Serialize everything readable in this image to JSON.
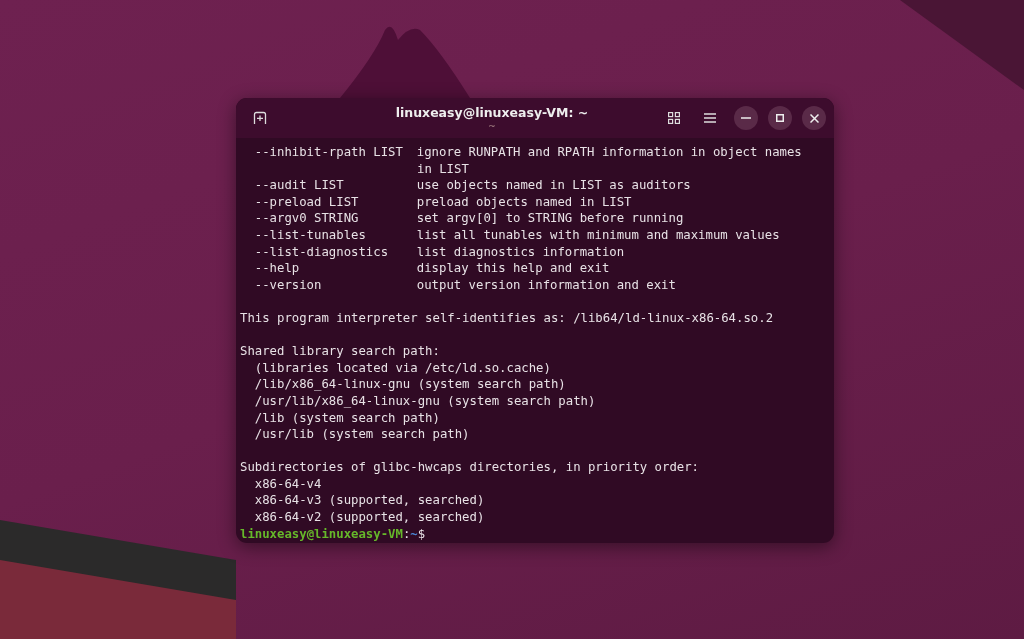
{
  "window": {
    "title": "linuxeasy@linuxeasy-VM: ~",
    "subtitle": "~"
  },
  "lines": [
    {
      "kind": "option",
      "option": "--inhibit-rpath LIST",
      "description": "ignore RUNPATH and RPATH information in object names"
    },
    {
      "kind": "continuation",
      "text": "in LIST"
    },
    {
      "kind": "option",
      "option": "--audit LIST",
      "description": "use objects named in LIST as auditors"
    },
    {
      "kind": "option",
      "option": "--preload LIST",
      "description": "preload objects named in LIST"
    },
    {
      "kind": "option",
      "option": "--argv0 STRING",
      "description": "set argv[0] to STRING before running"
    },
    {
      "kind": "option",
      "option": "--list-tunables",
      "description": "list all tunables with minimum and maximum values"
    },
    {
      "kind": "option",
      "option": "--list-diagnostics",
      "description": "list diagnostics information"
    },
    {
      "kind": "option",
      "option": "--help",
      "description": "display this help and exit"
    },
    {
      "kind": "option",
      "option": "--version",
      "description": "output version information and exit"
    },
    {
      "kind": "blank"
    },
    {
      "kind": "text",
      "text": "This program interpreter self-identifies as: /lib64/ld-linux-x86-64.so.2"
    },
    {
      "kind": "blank"
    },
    {
      "kind": "text",
      "text": "Shared library search path:"
    },
    {
      "kind": "indented",
      "text": "(libraries located via /etc/ld.so.cache)"
    },
    {
      "kind": "indented",
      "text": "/lib/x86_64-linux-gnu (system search path)"
    },
    {
      "kind": "indented",
      "text": "/usr/lib/x86_64-linux-gnu (system search path)"
    },
    {
      "kind": "indented",
      "text": "/lib (system search path)"
    },
    {
      "kind": "indented",
      "text": "/usr/lib (system search path)"
    },
    {
      "kind": "blank"
    },
    {
      "kind": "text",
      "text": "Subdirectories of glibc-hwcaps directories, in priority order:"
    },
    {
      "kind": "indented",
      "text": "x86-64-v4"
    },
    {
      "kind": "indented",
      "text": "x86-64-v3 (supported, searched)"
    },
    {
      "kind": "indented",
      "text": "x86-64-v2 (supported, searched)"
    },
    {
      "kind": "prompt",
      "user_host": "linuxeasy@linuxeasy-VM",
      "separator": ":",
      "path": "~",
      "symbol": "$"
    }
  ]
}
